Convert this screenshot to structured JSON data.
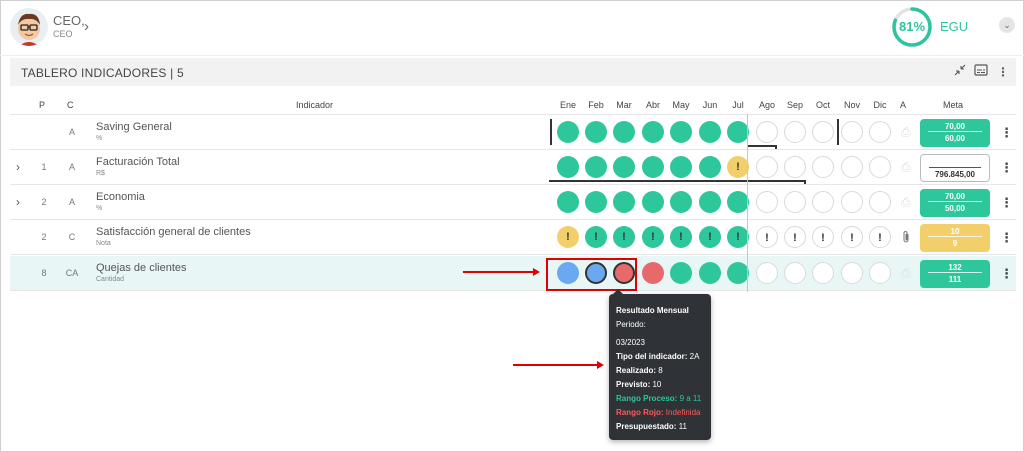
{
  "user": {
    "name": "CEO,",
    "role": "CEO"
  },
  "score": {
    "value": "81%",
    "label": "EGU",
    "fraction": 0.81,
    "color": "#2ec4a0"
  },
  "board": {
    "title": "TABLERO INDICADORES | 5"
  },
  "columns": {
    "p": "P",
    "c": "C",
    "indicator": "Indicador",
    "months": [
      "Ene",
      "Feb",
      "Mar",
      "Abr",
      "May",
      "Jun",
      "Jul",
      "Ago",
      "Sep",
      "Oct",
      "Nov",
      "Dic"
    ],
    "a": "A",
    "meta": "Meta"
  },
  "rows": [
    {
      "p": "",
      "c": "A",
      "name": "Saving General",
      "unit": "%",
      "meta1": "70,00",
      "meta2": "60,00",
      "states": [
        "green",
        "green",
        "green",
        "green",
        "green",
        "green",
        "green",
        "empty",
        "empty",
        "empty",
        "empty",
        "empty"
      ]
    },
    {
      "p": "1",
      "c": "A",
      "name": "Facturación Total",
      "unit": "R$",
      "meta1": "",
      "meta2": "796.845,00",
      "states": [
        "green",
        "green",
        "green",
        "green",
        "green",
        "green",
        "yellow",
        "empty",
        "empty",
        "empty",
        "empty",
        "empty"
      ]
    },
    {
      "p": "2",
      "c": "A",
      "name": "Economia",
      "unit": "%",
      "meta1": "70,00",
      "meta2": "50,00",
      "states": [
        "green",
        "green",
        "green",
        "green",
        "green",
        "green",
        "green",
        "empty",
        "empty",
        "empty",
        "empty",
        "empty"
      ]
    },
    {
      "p": "2",
      "c": "C",
      "name": "Satisfacción general de clientes",
      "unit": "Nota",
      "meta1": "10",
      "meta2": "9",
      "states": [
        "yellow",
        "green",
        "green",
        "green",
        "green",
        "green",
        "green",
        "empty",
        "empty",
        "empty",
        "empty",
        "empty"
      ]
    },
    {
      "p": "8",
      "c": "CA",
      "name": "Quejas de clientes",
      "unit": "Cantidad",
      "meta1": "132",
      "meta2": "111",
      "states": [
        "blue",
        "blue",
        "red",
        "red",
        "green",
        "green",
        "green",
        "empty",
        "empty",
        "empty",
        "empty",
        "empty"
      ]
    }
  ],
  "warning_glyph": "!",
  "tooltip": {
    "title": "Resultado Mensual",
    "period_label": "Periodo:",
    "period": "03/2023",
    "type_label": "Tipo del indicador:",
    "type": "2A",
    "real_label": "Realizado:",
    "real": "8",
    "plan_label": "Previsto:",
    "plan": "10",
    "range_proc_label": "Rango Proceso:",
    "range_proc": "9 a 11",
    "range_red_label": "Rango Rojo:",
    "range_red": "Indefinida",
    "budget_label": "Presupuestado:",
    "budget": "11"
  },
  "colors": {
    "green": "#2ec79b",
    "yellow": "#f2cf6b",
    "blue": "#6aa8f2",
    "red": "#e8696a",
    "annotation": "#e00000"
  }
}
